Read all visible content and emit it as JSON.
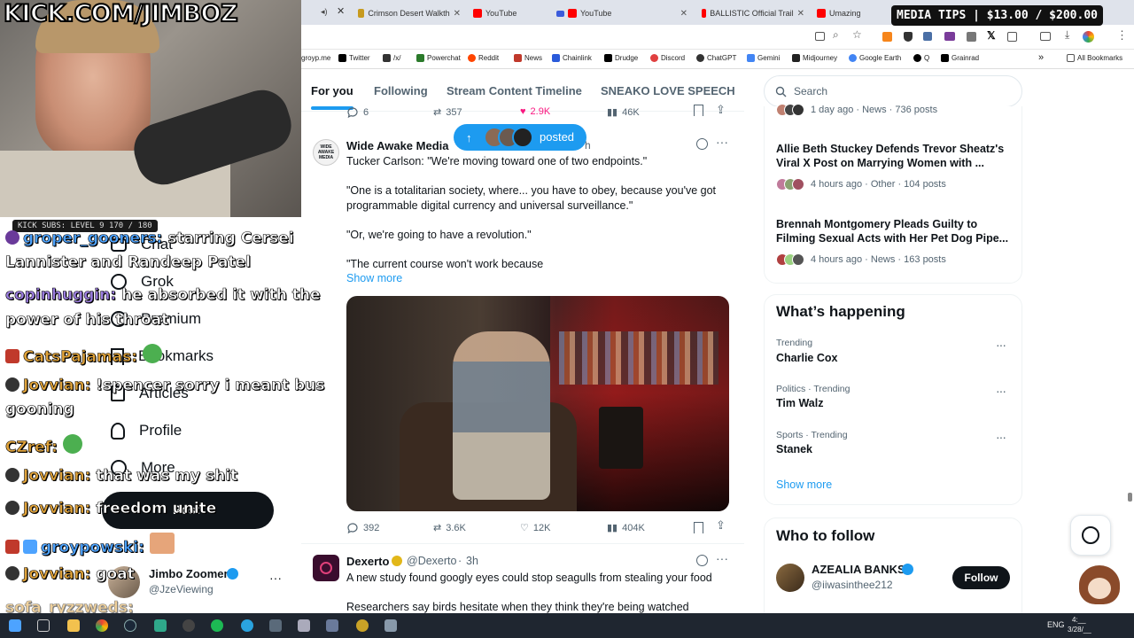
{
  "overlay": {
    "kick_logo": "KICK.COM/JIMBOZ",
    "kick_subs": "KICK SUBS: LEVEL 9 170 / 180",
    "media_tips": "MEDIA TIPS | $13.00 / $200.00"
  },
  "browser": {
    "tabs": [
      {
        "label": "Crimson Desert Walkth",
        "color": "#c79a1e"
      },
      {
        "label": "YouTube",
        "color": "#ff0000"
      },
      {
        "label": "YouTube",
        "color": "#ff0000"
      },
      {
        "label": "BALLISTIC Official Trail",
        "color": "#ff0000"
      },
      {
        "label": "Umazing",
        "color": "#ff0000"
      }
    ],
    "bookmarks": [
      {
        "label": "groyp.me",
        "color": "#888888"
      },
      {
        "label": "Twitter",
        "color": "#000000"
      },
      {
        "label": "/x/",
        "color": "#333333"
      },
      {
        "label": "Powerchat",
        "color": "#2b7a2b"
      },
      {
        "label": "Reddit",
        "color": "#ff4500"
      },
      {
        "label": "News",
        "color": "#c0392b"
      },
      {
        "label": "Chainlink",
        "color": "#2a5ada"
      },
      {
        "label": "Drudge",
        "color": "#000000"
      },
      {
        "label": "Discord",
        "color": "#e04040"
      },
      {
        "label": "ChatGPT",
        "color": "#333333"
      },
      {
        "label": "Gemini",
        "color": "#4285f4"
      },
      {
        "label": "Midjourney",
        "color": "#222222"
      },
      {
        "label": "Google Earth",
        "color": "#4285f4"
      },
      {
        "label": "Q",
        "color": "#000000"
      },
      {
        "label": "Grainrad",
        "color": "#000000"
      }
    ],
    "all_bookmarks": "All Bookmarks"
  },
  "nav": {
    "items": [
      {
        "label": "Chat",
        "icon": "chat-icon"
      },
      {
        "label": "Grok",
        "icon": "grok-icon"
      },
      {
        "label": "Premium",
        "icon": "premium-icon"
      },
      {
        "label": "Bookmarks",
        "icon": "bookmark-icon"
      },
      {
        "label": "Articles",
        "icon": "article-icon"
      },
      {
        "label": "Profile",
        "icon": "profile-icon"
      },
      {
        "label": "More",
        "icon": "more-icon"
      }
    ],
    "post_label": "Post",
    "account": {
      "name": "Jimbo Zoomer",
      "handle": "@JzeViewing"
    }
  },
  "chat": [
    {
      "user": "groper_gooners:",
      "text": "starring Cersei",
      "color": "blue"
    },
    {
      "user": "",
      "text": "Lannister and Randeep Patel",
      "color": ""
    },
    {
      "user": "copinhuggin:",
      "text": "he absorbed it with the",
      "color": "purple"
    },
    {
      "user": "",
      "text": "power of his throat",
      "color": ""
    },
    {
      "user": "CatsPajamas:",
      "text": "",
      "color": "orange"
    },
    {
      "user": "Jovvian:",
      "text": "!spencer sorry i meant bus",
      "color": "orange"
    },
    {
      "user": "",
      "text": "gooning",
      "color": ""
    },
    {
      "user": "CZref:",
      "text": "",
      "color": "orange"
    },
    {
      "user": "Jovvian:",
      "text": "that was my shit",
      "color": "orange"
    },
    {
      "user": "Jovvian:",
      "text": "freedom unite",
      "color": "orange"
    },
    {
      "user": "groypowski:",
      "text": "",
      "color": "blue"
    },
    {
      "user": "Jovvian:",
      "text": "goat",
      "color": "orange"
    },
    {
      "user": "sofa_ryzzweds:",
      "text": "",
      "color": "orange"
    }
  ],
  "feed": {
    "tabs": [
      "For you",
      "Following",
      "Stream Content Timeline",
      "SNEAKO LOVE SPEECH"
    ],
    "prev_actions": {
      "replies": "6",
      "reposts": "357",
      "likes": "2.9K",
      "views": "46K"
    },
    "posted_pill": "posted",
    "tweet1": {
      "name": "Wide Awake Media",
      "avatar_text": "WIDE AWAKE MEDIA",
      "time_suffix": "h",
      "lines": [
        "Tucker Carlson: \"We're moving toward one of two endpoints.\"",
        "\"One is a totalitarian society, where... you have to obey, because you've got programmable digital currency and universal surveillance.\"",
        "\"Or, we're going to have a revolution.\"",
        "\"The current course won't work because"
      ],
      "show_more": "Show more",
      "actions": {
        "replies": "392",
        "reposts": "3.6K",
        "likes": "12K",
        "views": "404K"
      }
    },
    "tweet2": {
      "name": "Dexerto",
      "handle": "@Dexerto",
      "time": "3h",
      "lines": [
        "A new study found googly eyes could stop seagulls from stealing your food",
        "Researchers say birds hesitate when they think they're being watched"
      ]
    }
  },
  "sidebar": {
    "search_placeholder": "Search",
    "top_meta": "1 day ago · News · 736 posts",
    "news": [
      {
        "headline": "Allie Beth Stuckey Defends Trevor Sheatz's Viral X Post on Marrying Women with ...",
        "meta": "4 hours ago · Other · 104 posts"
      },
      {
        "headline": "Brennah Montgomery Pleads Guilty to Filming Sexual Acts with Her Pet Dog Pipe...",
        "meta": "4 hours ago · News · 163 posts"
      }
    ],
    "whats_happening": "What’s happening",
    "trends": [
      {
        "context": "Trending",
        "name": "Charlie Cox"
      },
      {
        "context": "Politics · Trending",
        "name": "Tim Walz"
      },
      {
        "context": "Sports · Trending",
        "name": "Stanek"
      }
    ],
    "show_more": "Show more",
    "who_to_follow": "Who to follow",
    "follow_suggestion": {
      "name": "AZEALIA BANKS",
      "handle": "@iiwasinthee212",
      "button": "Follow"
    }
  },
  "taskbar": {
    "lang": "ENG",
    "time": "4:__",
    "date": "3/28/__"
  }
}
